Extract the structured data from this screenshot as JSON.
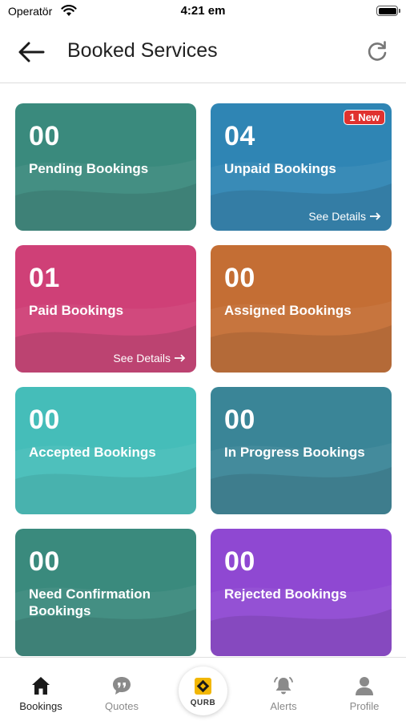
{
  "status_bar": {
    "carrier": "Operatör",
    "time": "4:21 em"
  },
  "header": {
    "title": "Booked Services"
  },
  "cards": [
    {
      "count": "00",
      "label": "Pending Bookings",
      "color": "#3a8a7d"
    },
    {
      "count": "04",
      "label": "Unpaid Bookings",
      "details": "See Details",
      "badge": "1 New",
      "color": "#2f85b4"
    },
    {
      "count": "01",
      "label": "Paid Bookings",
      "details": "See Details",
      "color": "#cf4077"
    },
    {
      "count": "00",
      "label": "Assigned Bookings",
      "color": "#c46e34"
    },
    {
      "count": "00",
      "label": "Accepted Bookings",
      "color": "#45bdb9"
    },
    {
      "count": "00",
      "label": "In Progress Bookings",
      "color": "#3a8597"
    },
    {
      "count": "00",
      "label": "Need Confirmation Bookings",
      "color": "#3a8a7d"
    },
    {
      "count": "00",
      "label": "Rejected Bookings",
      "color": "#8f48d2"
    }
  ],
  "tabs": {
    "bookings": "Bookings",
    "quotes": "Quotes",
    "qurb": "QURB",
    "alerts": "Alerts",
    "profile": "Profile"
  },
  "icons": {
    "back": "arrow-left-icon",
    "refresh": "refresh-icon",
    "bookings": "home-icon",
    "quotes": "chat-quote-icon",
    "alerts": "bell-icon",
    "profile": "user-icon"
  }
}
